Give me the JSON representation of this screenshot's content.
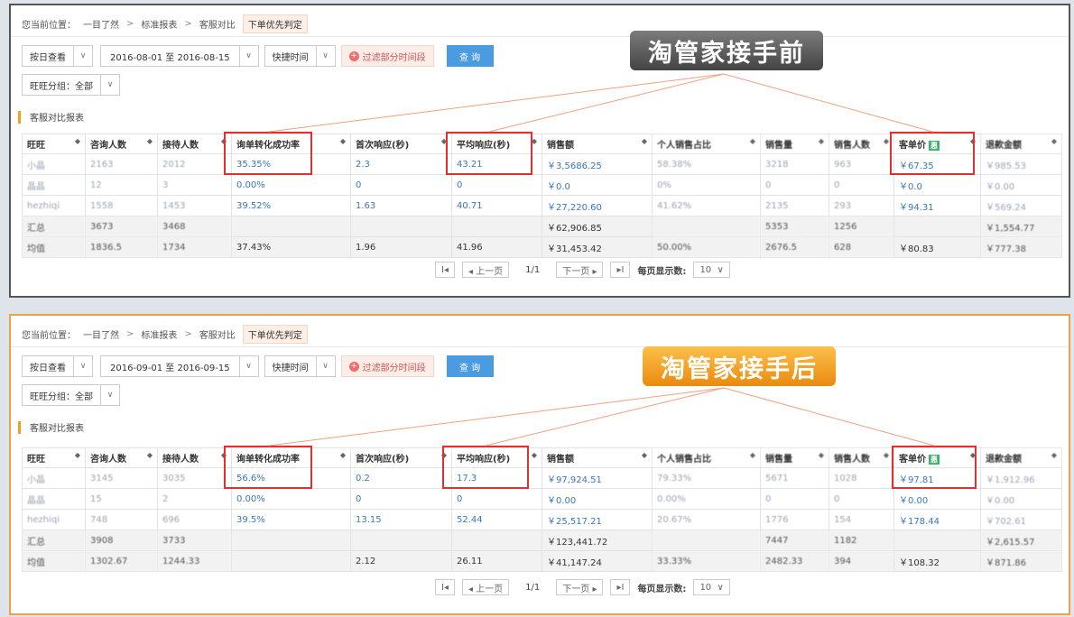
{
  "before": {
    "breadcrumb": [
      "您当前位置：",
      "一目了然",
      "标准报表",
      "客服对比",
      "下单优先判定"
    ],
    "view_mode": "按日查看",
    "date_range": "2016-08-01 至 2016-08-15",
    "quick_time": "快捷时间",
    "filter_label": "过滤部分时间段",
    "query_label": "查 询",
    "group_label": "旺旺分组：全部",
    "section_title": "客服对比报表",
    "banner": "淘管家接手前",
    "headers": [
      "旺旺",
      "咨询人数",
      "接待人数",
      "询单转化成功率",
      "首次响应(秒)",
      "平均响应(秒)",
      "销售额",
      "个人销售占比",
      "销售量",
      "销售人数",
      "客单价",
      "退款金额"
    ],
    "rows": [
      [
        "小晶",
        "2163",
        "2012",
        "35.35%",
        "2.3",
        "43.21",
        "￥3,5686.25",
        "58.38%",
        "3218",
        "963",
        "￥67.35",
        "￥985.53"
      ],
      [
        "晶晶",
        "12",
        "3",
        "0.00%",
        "0",
        "0",
        "￥0.0",
        "0%",
        "0",
        "0",
        "￥0.0",
        "￥0.00"
      ],
      [
        "hezhiqi",
        "1558",
        "1453",
        "39.52%",
        "1.63",
        "40.71",
        "￥27,220.60",
        "41.62%",
        "2135",
        "293",
        "￥94.31",
        "￥569.24"
      ],
      [
        "汇总",
        "3673",
        "3468",
        "",
        "",
        "",
        "￥62,906.85",
        "",
        "5353",
        "1256",
        "",
        "￥1,554.77"
      ],
      [
        "均值",
        "1836.5",
        "1734",
        "37.43%",
        "1.96",
        "41.96",
        "￥31,453.42",
        "50.00%",
        "2676.5",
        "628",
        "￥80.83",
        "￥777.38"
      ]
    ],
    "pager": {
      "first": "I◂",
      "prev": "◂ 上一页",
      "page": "1/1",
      "next": "下一页 ▸",
      "last": "▸I",
      "size_label": "每页显示数:",
      "size": "10"
    }
  },
  "after": {
    "breadcrumb": [
      "您当前位置：",
      "一目了然",
      "标准报表",
      "客服对比",
      "下单优先判定"
    ],
    "view_mode": "按日查看",
    "date_range": "2016-09-01 至 2016-09-15",
    "quick_time": "快捷时间",
    "filter_label": "过滤部分时间段",
    "query_label": "查 询",
    "group_label": "旺旺分组：全部",
    "section_title": "客服对比报表",
    "banner": "淘管家接手后",
    "headers": [
      "旺旺",
      "咨询人数",
      "接待人数",
      "询单转化成功率",
      "首次响应(秒)",
      "平均响应(秒)",
      "销售额",
      "个人销售占比",
      "销售量",
      "销售人数",
      "客单价",
      "退款金额"
    ],
    "rows": [
      [
        "小晶",
        "3145",
        "3035",
        "56.6%",
        "0.2",
        "17.3",
        "￥97,924.51",
        "79.33%",
        "5671",
        "1028",
        "￥97.81",
        "￥1,912.96"
      ],
      [
        "晶晶",
        "15",
        "2",
        "0.00%",
        "0",
        "0",
        "￥0.00",
        "0.00%",
        "0",
        "0",
        "￥0.00",
        "￥0.00"
      ],
      [
        "hezhiqi",
        "748",
        "696",
        "39.5%",
        "13.15",
        "52.44",
        "￥25,517.21",
        "20.67%",
        "1776",
        "154",
        "￥178.44",
        "￥702.61"
      ],
      [
        "汇总",
        "3908",
        "3733",
        "",
        "",
        "",
        "￥123,441.72",
        "",
        "7447",
        "1182",
        "",
        "￥2,615.57"
      ],
      [
        "均值",
        "1302.67",
        "1244.33",
        "",
        "2.12",
        "26.11",
        "￥41,147.24",
        "33.33%",
        "2482.33",
        "394",
        "￥108.32",
        "￥871.86"
      ]
    ],
    "pager": {
      "first": "I◂",
      "prev": "◂ 上一页",
      "page": "1/1",
      "next": "下一页 ▸",
      "last": "▸I",
      "size_label": "每页显示数:",
      "size": "10"
    }
  },
  "tag_label": "惠",
  "colors": {
    "highlight": "#e03030",
    "link": "#3a77b8",
    "accent_orange": "#f0a04a",
    "query_blue": "#4a9be0"
  }
}
